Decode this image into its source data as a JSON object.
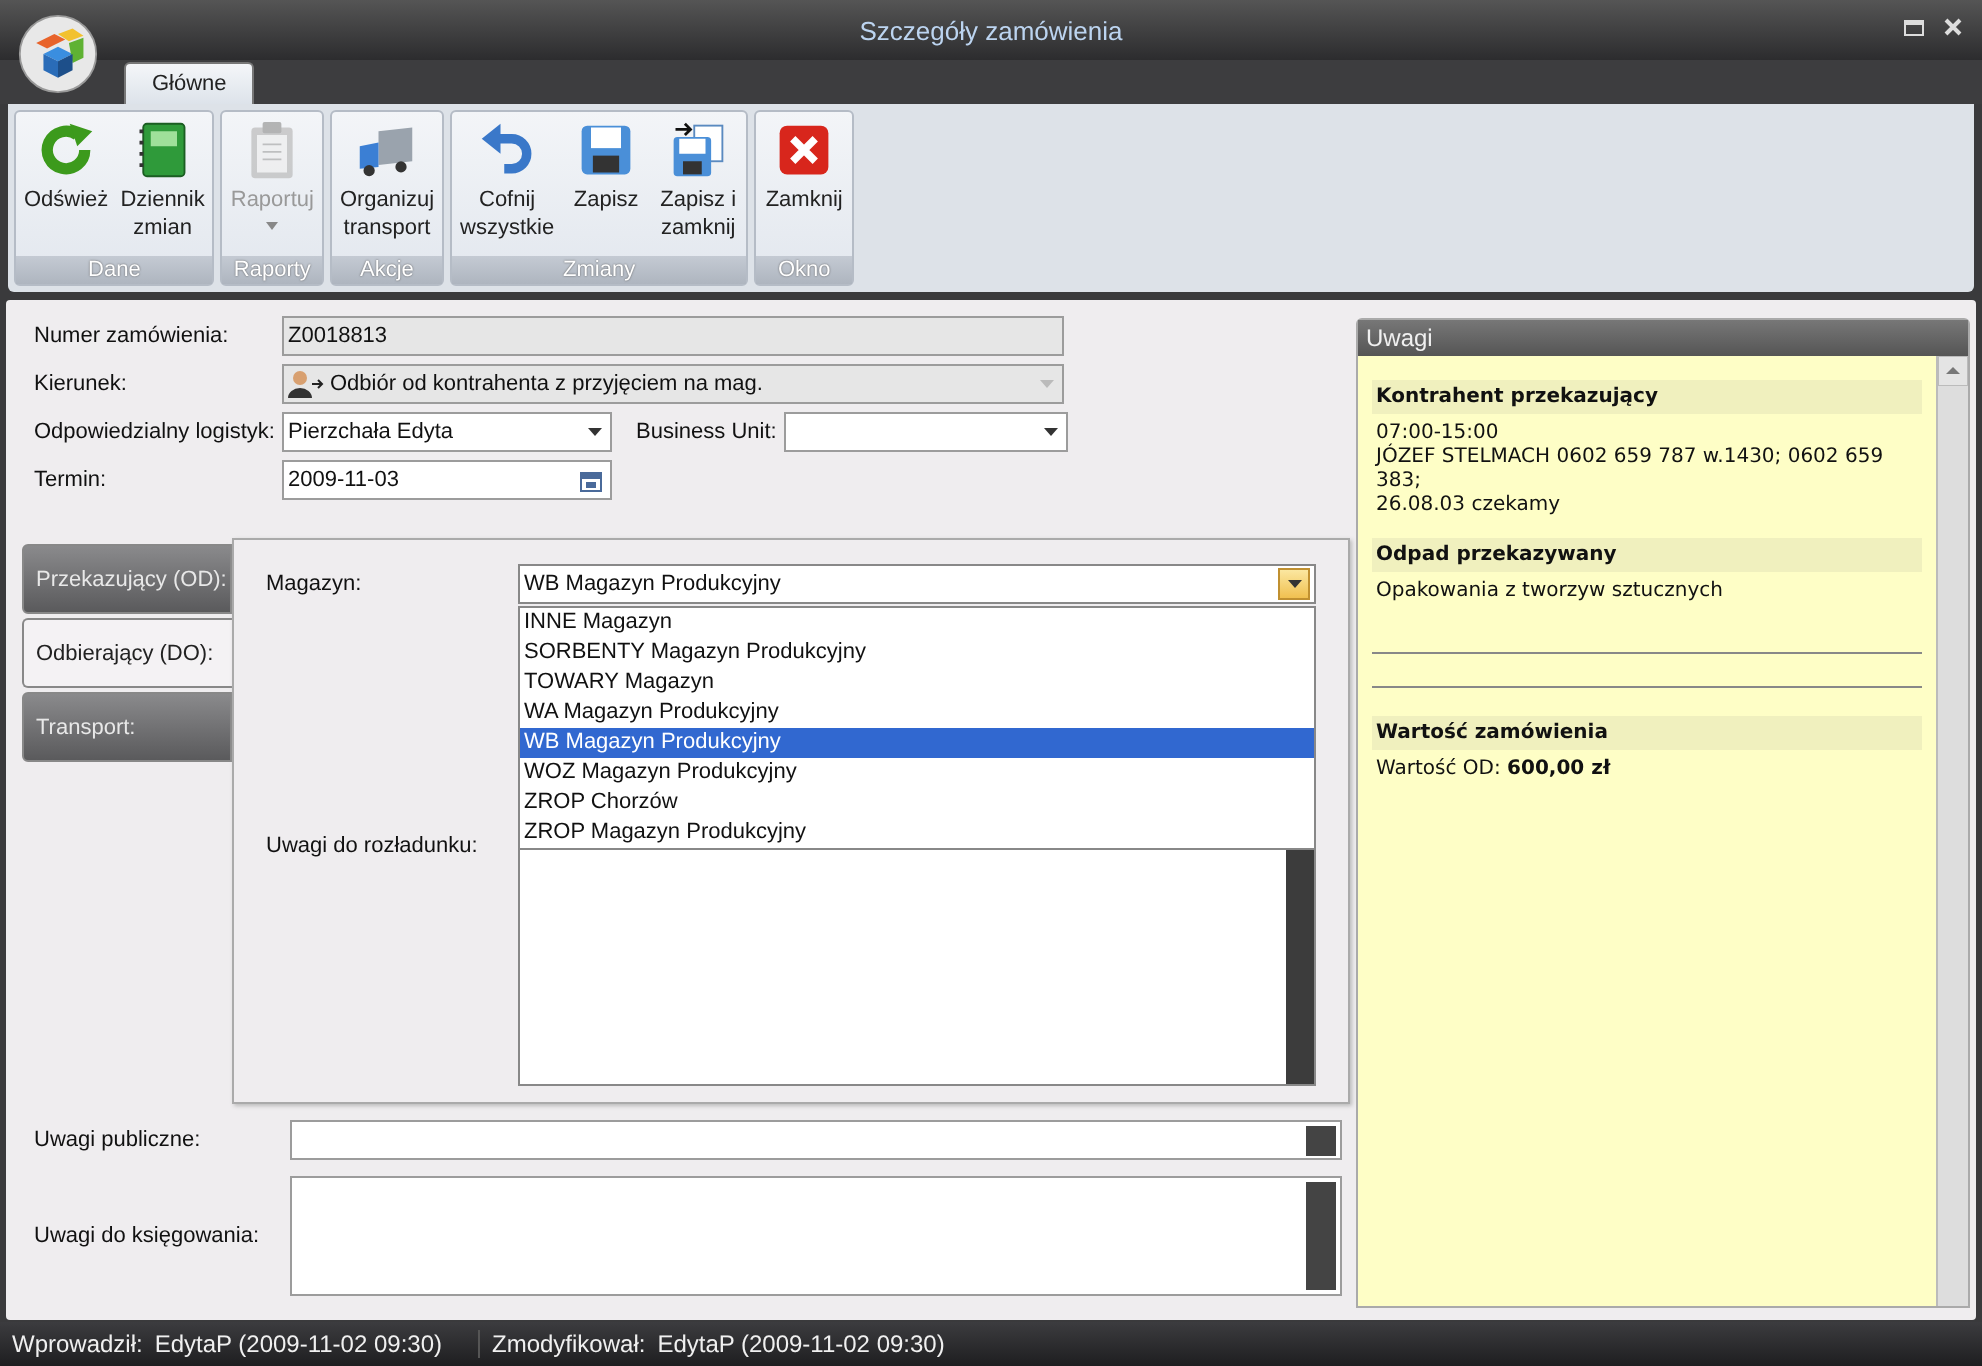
{
  "window": {
    "title": "Szczegóły zamówienia"
  },
  "ribbon": {
    "tabs": [
      {
        "label": "Główne",
        "selected": true
      }
    ],
    "groups": [
      {
        "label": "Dane",
        "buttons": [
          {
            "label": "Odśwież",
            "kind": "refresh",
            "disabled": false
          },
          {
            "label": "Dziennik zmian",
            "kind": "journal",
            "disabled": false
          }
        ]
      },
      {
        "label": "Raporty",
        "buttons": [
          {
            "label": "Raportuj",
            "kind": "clipboard",
            "disabled": true,
            "dropdown": true
          }
        ]
      },
      {
        "label": "Akcje",
        "buttons": [
          {
            "label": "Organizuj transport",
            "kind": "truck",
            "disabled": false
          }
        ]
      },
      {
        "label": "Zmiany",
        "buttons": [
          {
            "label": "Cofnij wszystkie",
            "kind": "undo",
            "disabled": false
          },
          {
            "label": "Zapisz",
            "kind": "save",
            "disabled": false
          },
          {
            "label": "Zapisz i zamknij",
            "kind": "save-close",
            "disabled": false
          }
        ]
      },
      {
        "label": "Okno",
        "buttons": [
          {
            "label": "Zamknij",
            "kind": "close",
            "disabled": false
          }
        ]
      }
    ]
  },
  "form": {
    "order_number": {
      "label": "Numer zamówienia:",
      "value": "Z0018813"
    },
    "direction": {
      "label": "Kierunek:",
      "value": "Odbiór od kontrahenta z przyjęciem na mag.",
      "disabled": true
    },
    "logistician": {
      "label": "Odpowiedzialny logistyk:",
      "value": "Pierzchała Edyta"
    },
    "business_unit": {
      "label": "Business Unit:"
    },
    "deadline": {
      "label": "Termin:",
      "value": "2009-11-03"
    }
  },
  "side_tabs": [
    {
      "label": "Przekazujący (OD):",
      "selected": false
    },
    {
      "label": "Odbierający (DO):",
      "selected": true
    },
    {
      "label": "Transport:",
      "selected": false
    }
  ],
  "panel": {
    "warehouse_label": "Magazyn:",
    "warehouse_value": "WB Magazyn Produkcyjny",
    "options": [
      {
        "label": "INNE Magazyn",
        "selected": false
      },
      {
        "label": "SORBENTY Magazyn Produkcyjny",
        "selected": false
      },
      {
        "label": "TOWARY Magazyn",
        "selected": false
      },
      {
        "label": "WA Magazyn Produkcyjny",
        "selected": false
      },
      {
        "label": "WB Magazyn Produkcyjny",
        "selected": true
      },
      {
        "label": "WOZ Magazyn Produkcyjny",
        "selected": false
      },
      {
        "label": "ZROP Chorzów",
        "selected": false
      },
      {
        "label": "ZROP Magazyn Produkcyjny",
        "selected": false
      }
    ],
    "unloading_notes_label": "Uwagi do rozładunku:"
  },
  "public_notes": {
    "label": "Uwagi publiczne:"
  },
  "accounting_notes": {
    "label": "Uwagi do księgowania:"
  },
  "notes_panel": {
    "title": "Uwagi",
    "sections": [
      {
        "heading": "Kontrahent przekazujący",
        "lines": [
          "07:00-15:00",
          "JÓZEF STELMACH 0602 659 787 w.1430; 0602 659 383;",
          "26.08.03 czekamy"
        ]
      },
      {
        "heading": "Odpad przekazywany",
        "lines": [
          "Opakowania z tworzyw sztucznych"
        ]
      },
      {
        "heading": "Wartość zamówienia",
        "lines": [
          "Wartość OD: **600,00 zł**"
        ]
      }
    ]
  },
  "status_bar": [
    {
      "label": "Wprowadził:",
      "value": "EdytaP (2009-11-02 09:30)"
    },
    {
      "label": "Zmodyfikował:",
      "value": "EdytaP (2009-11-02 09:30)"
    }
  ]
}
